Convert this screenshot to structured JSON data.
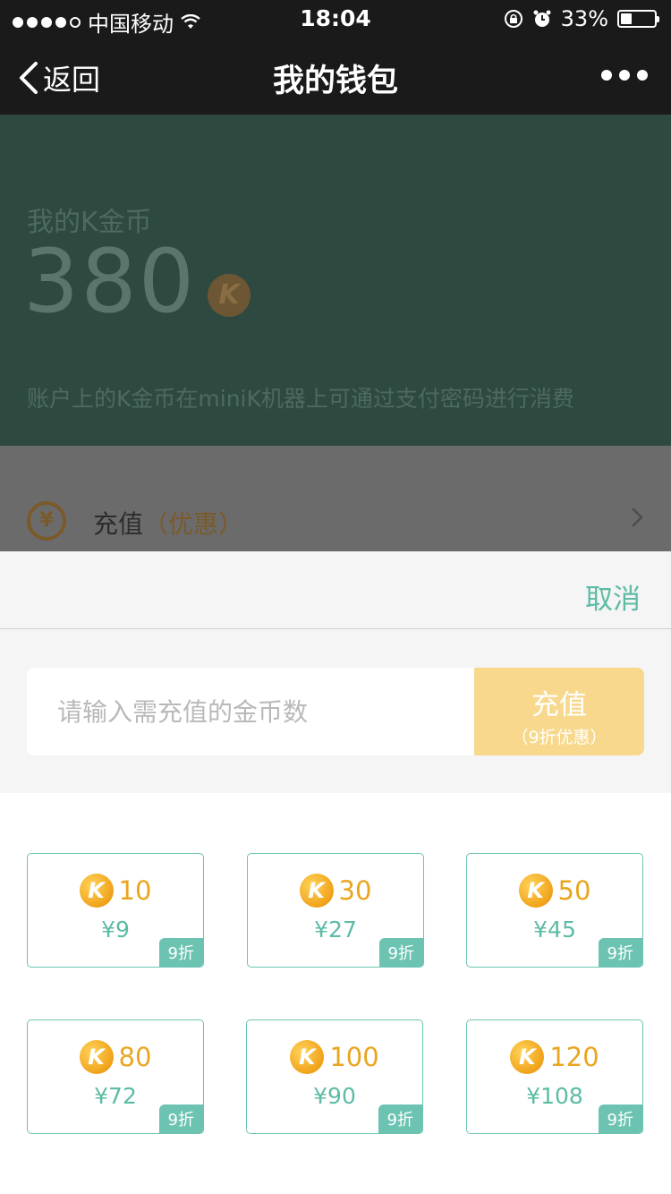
{
  "status_bar": {
    "carrier": "中国移动",
    "time": "18:04",
    "battery": "33%"
  },
  "nav": {
    "back_label": "返回",
    "title": "我的钱包"
  },
  "wallet": {
    "label": "我的K金币",
    "balance": "380",
    "coin_symbol": "K",
    "description": "账户上的K金币在miniK机器上可通过支付密码进行消费"
  },
  "recharge_row": {
    "label": "充值",
    "discount": "（优惠）",
    "icon": "¥"
  },
  "sheet": {
    "cancel_label": "取消",
    "input_placeholder": "请输入需充值的金币数",
    "button_label": "充值",
    "button_sub": "（9折优惠）",
    "options": [
      {
        "coins": "10",
        "price": "¥9",
        "badge": "9折"
      },
      {
        "coins": "30",
        "price": "¥27",
        "badge": "9折"
      },
      {
        "coins": "50",
        "price": "¥45",
        "badge": "9折"
      },
      {
        "coins": "80",
        "price": "¥72",
        "badge": "9折"
      },
      {
        "coins": "100",
        "price": "¥90",
        "badge": "9折"
      },
      {
        "coins": "120",
        "price": "¥108",
        "badge": "9折"
      }
    ]
  },
  "colors": {
    "accent": "#5dbba6",
    "gold": "#e9a51e",
    "button": "#f7d88c"
  }
}
